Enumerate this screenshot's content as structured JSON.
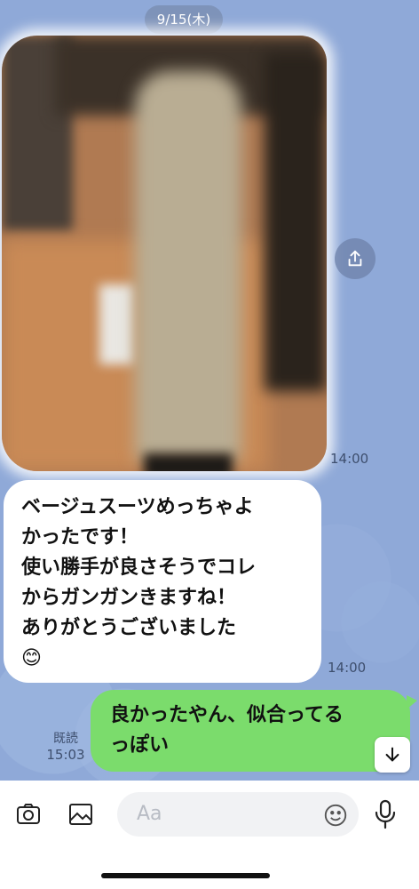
{
  "chat": {
    "date": "9/15(木)",
    "photo_time": "14:00",
    "incoming_message": "ベージュスーツめっちゃよ\nかったです！\n使い勝手が良さそうでコレ\nからガンガンきますね！\nありがとうございました\n😊",
    "incoming_time": "14:00",
    "outgoing_message": "良かったやん、似合ってる\nっぽい",
    "read_label": "既読",
    "outgoing_time": "15:03"
  },
  "input_bar": {
    "placeholder": "Aa"
  },
  "icons": {
    "share": "share-icon",
    "scroll_down": "arrow-down-icon",
    "camera": "camera-icon",
    "image": "image-icon",
    "emoji": "emoji-icon",
    "mic": "microphone-icon"
  },
  "colors": {
    "chat_background": "#8fa9d8",
    "outgoing_bubble": "#7bdc6c",
    "incoming_bubble": "#ffffff"
  }
}
